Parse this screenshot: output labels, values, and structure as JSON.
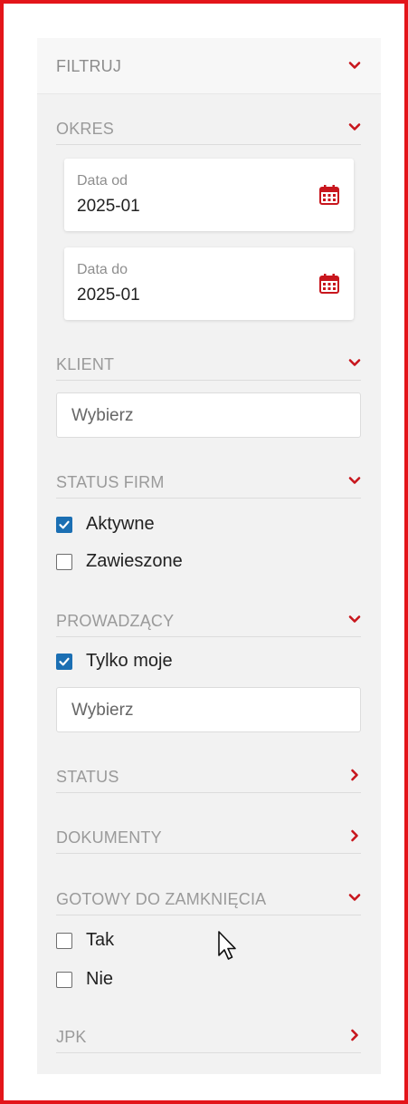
{
  "panel": {
    "title": "FILTRUJ"
  },
  "okres": {
    "title": "OKRES",
    "date_from": {
      "label": "Data od",
      "value": "2025-01"
    },
    "date_to": {
      "label": "Data do",
      "value": "2025-01"
    }
  },
  "klient": {
    "title": "KLIENT",
    "placeholder": "Wybierz"
  },
  "status_firm": {
    "title": "STATUS FIRM",
    "options": [
      {
        "label": "Aktywne",
        "checked": true
      },
      {
        "label": "Zawieszone",
        "checked": false
      }
    ]
  },
  "prowadzacy": {
    "title": "PROWADZĄCY",
    "only_mine": {
      "label": "Tylko moje",
      "checked": true
    },
    "placeholder": "Wybierz"
  },
  "status": {
    "title": "STATUS"
  },
  "dokumenty": {
    "title": "DOKUMENTY"
  },
  "gotowy": {
    "title": "GOTOWY DO ZAMKNIĘCIA",
    "options": [
      {
        "label": "Tak",
        "checked": false
      },
      {
        "label": "Nie",
        "checked": false
      }
    ]
  },
  "jpk": {
    "title": "JPK"
  },
  "colors": {
    "accent": "#c8161d",
    "frame": "#e3151a",
    "checkbox": "#1b6fb3"
  },
  "icons": {
    "expanded": "chevron-down-icon",
    "collapsed": "chevron-right-icon",
    "calendar": "calendar-icon"
  }
}
